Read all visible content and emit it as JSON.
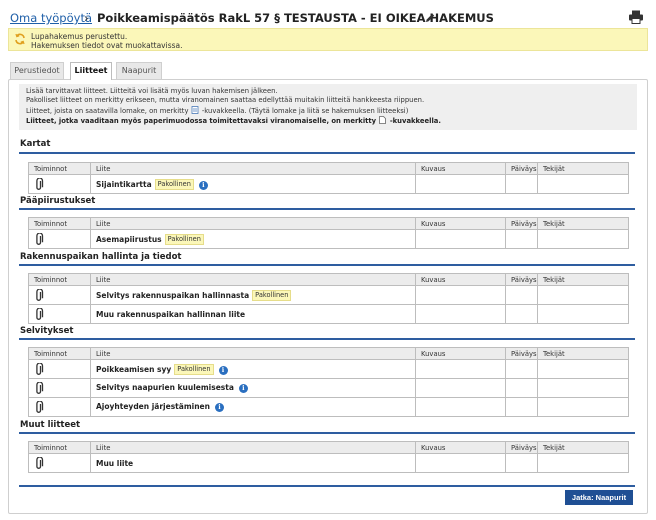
{
  "header": {
    "breadcrumb": "Oma työpöytä",
    "separator": "›",
    "title": "Poikkeamispäätös RakL 57 § TESTAUSTA - EI OIKEA HAKEMUS"
  },
  "notice": {
    "line1": "Lupahakemus perustettu.",
    "line2": "Hakemuksen tiedot ovat muokattavissa."
  },
  "tabs": [
    {
      "label": "Perustiedot"
    },
    {
      "label": "Liitteet"
    },
    {
      "label": "Naapurit"
    }
  ],
  "info": {
    "line1": "Lisää tarvittavat liitteet. Liitteitä voi lisätä myös luvan hakemisen jälkeen.",
    "line2": "Pakolliset liitteet on merkitty erikseen, mutta viranomainen saattaa edellyttää muitakin liitteitä hankkeesta riippuen.",
    "line3a": "Liitteet, joista on saatavilla lomake, on merkitty",
    "line3b": "-kuvakkeella. (Täytä lomake ja liitä se hakemuksen liitteeksi)",
    "line4a": "Liitteet, jotka vaaditaan myös paperimuodossa toimitettavaksi viranomaiselle, on merkitty",
    "line4b": "-kuvakkeella."
  },
  "columns": {
    "actions": "Toiminnot",
    "attachment": "Liite",
    "description": "Kuvaus",
    "date": "Päiväys",
    "author": "Tekijät"
  },
  "sections": [
    {
      "title": "Kartat",
      "rows": [
        {
          "name": "Sijaintikartta",
          "badge": "Pakollinen",
          "info": true
        }
      ]
    },
    {
      "title": "Pääpiirustukset",
      "rows": [
        {
          "name": "Asemapiirustus",
          "badge": "Pakollinen",
          "info": false
        }
      ]
    },
    {
      "title": "Rakennuspaikan hallinta ja tiedot",
      "rows": [
        {
          "name": "Selvitys rakennuspaikan hallinnasta",
          "badge": "Pakollinen",
          "info": false
        },
        {
          "name": "Muu rakennuspaikan hallinnan liite",
          "badge": "",
          "info": false
        }
      ]
    },
    {
      "title": "Selvitykset",
      "rows": [
        {
          "name": "Poikkeamisen syy",
          "badge": "Pakollinen",
          "info": true
        },
        {
          "name": "Selvitys naapurien kuulemisesta",
          "badge": "",
          "info": true
        },
        {
          "name": "Ajoyhteyden järjestäminen",
          "badge": "",
          "info": true
        }
      ]
    },
    {
      "title": "Muut liitteet",
      "rows": [
        {
          "name": "Muu liite",
          "badge": "",
          "info": false
        }
      ]
    }
  ],
  "next_button": "Jatka: Naapurit",
  "colors": {
    "accent": "#2e5da0",
    "button": "#1f4f94",
    "notice_bg": "#fbf7b9"
  },
  "icons": {
    "edit": "pencil-icon",
    "print": "printer-icon",
    "refresh": "refresh-icon",
    "attach": "paperclip-icon",
    "info": "info-icon",
    "form": "form-icon",
    "paper": "document-icon"
  }
}
